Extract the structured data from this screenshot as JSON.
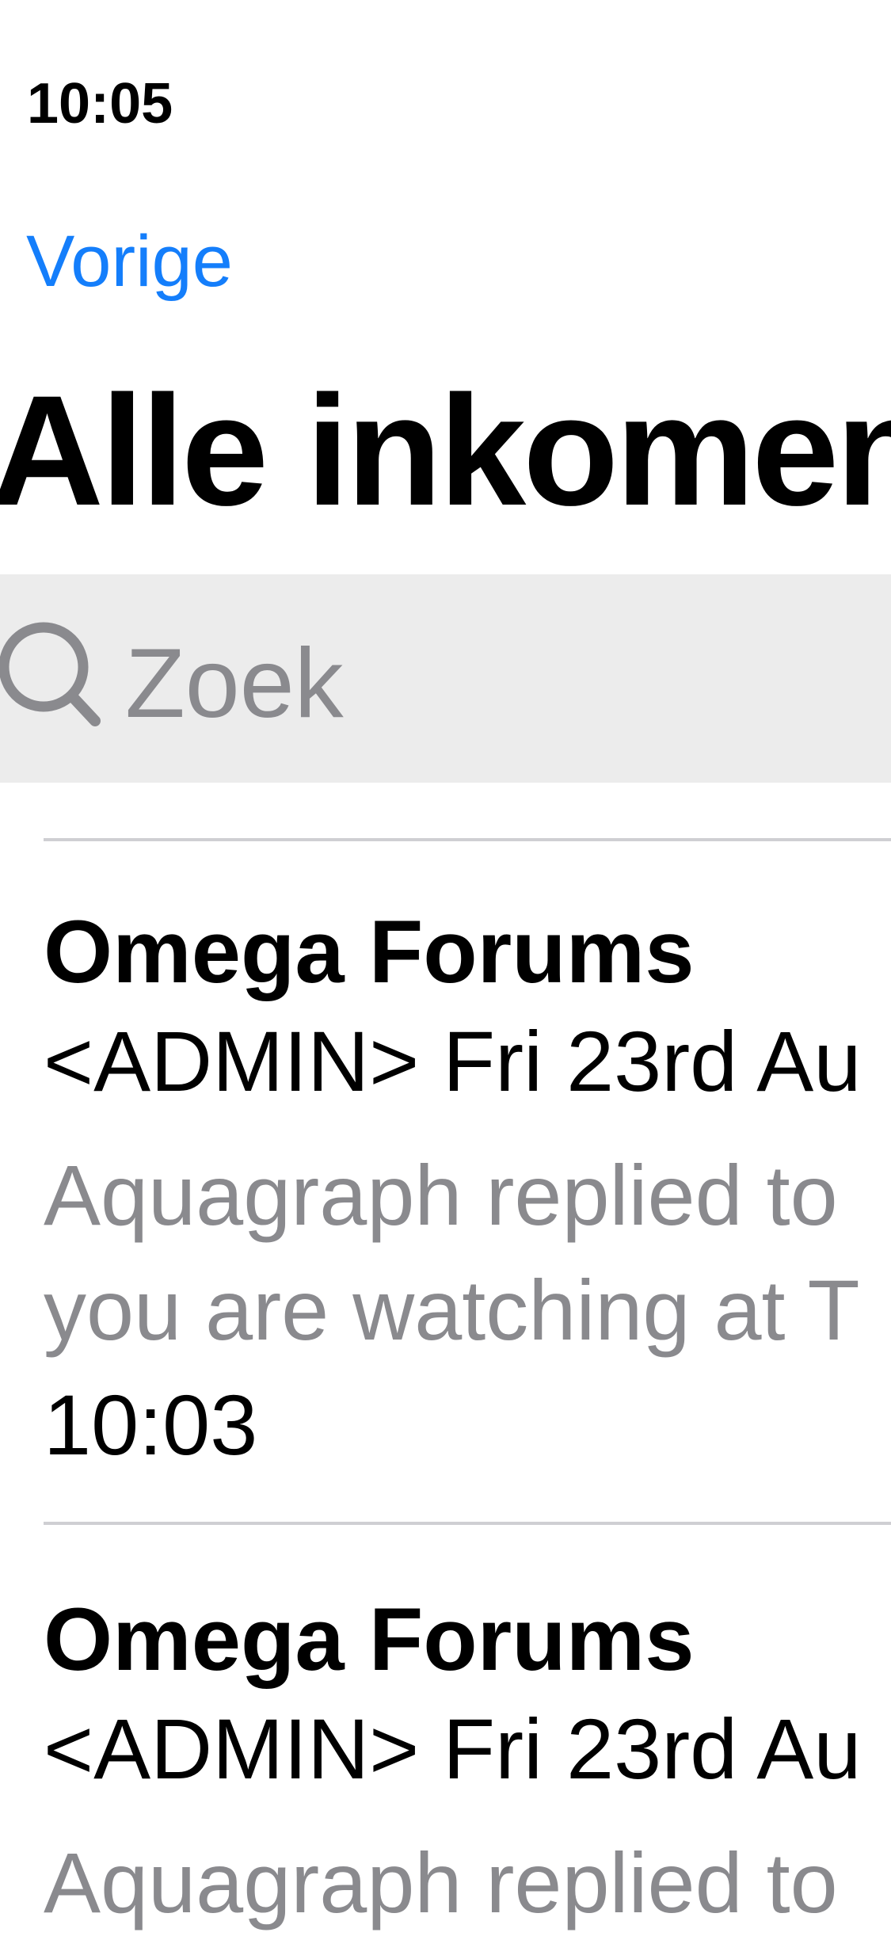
{
  "status_bar": {
    "time": "10:05"
  },
  "nav": {
    "back_label": "Vorige",
    "title": "Alle inkomen"
  },
  "search": {
    "placeholder": "Zoek"
  },
  "messages": [
    {
      "sender": "Omega Forums",
      "subject": "<ADMIN> Fri 23rd Au",
      "preview_line1": "Aquagraph replied to",
      "preview_line2": "you are watching at T",
      "time": "10:03"
    },
    {
      "sender": "Omega Forums",
      "subject": "<ADMIN> Fri 23rd Au",
      "preview_line1": "Aquagraph replied to"
    }
  ],
  "colors": {
    "accent": "#147EFB",
    "secondary_text": "#8A8A8E",
    "search_background": "#ECECEC",
    "divider": "#CFCFD3"
  }
}
